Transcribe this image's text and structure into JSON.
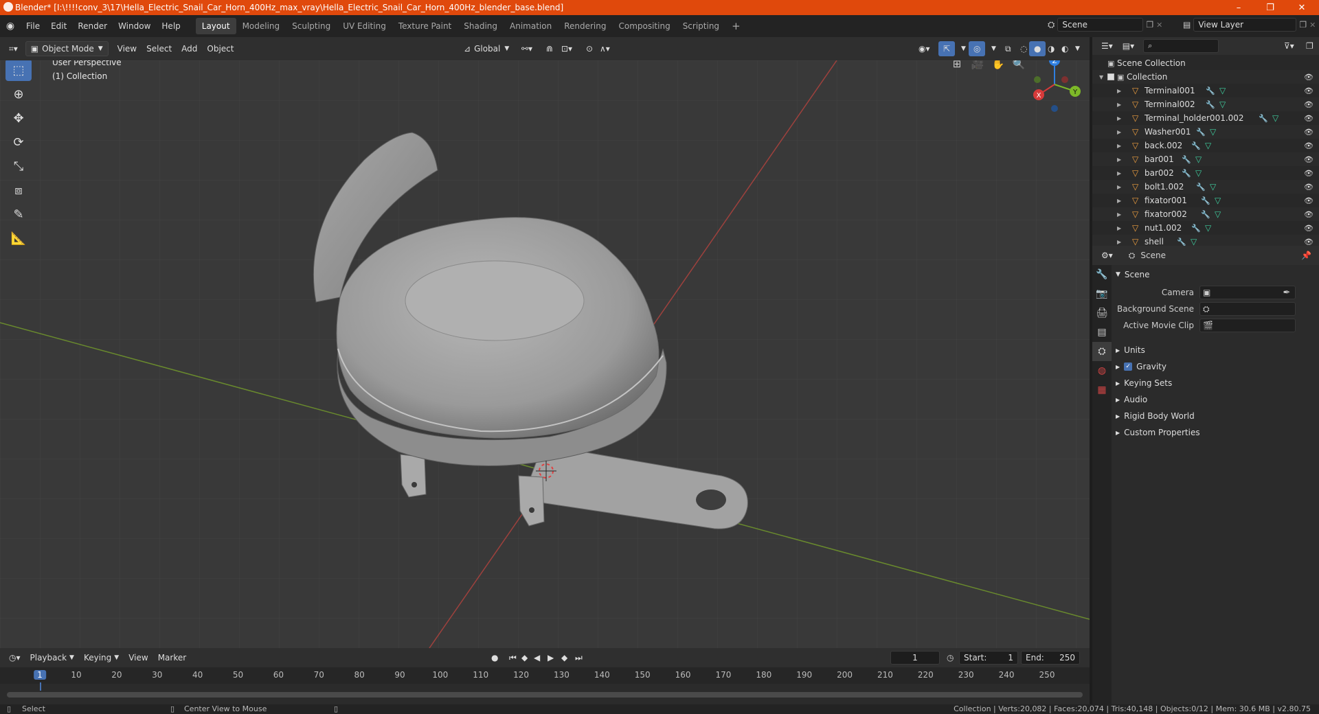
{
  "titlebar": {
    "title": "Blender* [I:\\!!!!conv_3\\17\\Hella_Electric_Snail_Car_Horn_400Hz_max_vray\\Hella_Electric_Snail_Car_Horn_400Hz_blender_base.blend]",
    "minimize": "–",
    "restore": "❐",
    "close": "✕"
  },
  "menu": [
    "File",
    "Edit",
    "Render",
    "Window",
    "Help"
  ],
  "workspaces": [
    "Layout",
    "Modeling",
    "Sculpting",
    "UV Editing",
    "Texture Paint",
    "Shading",
    "Animation",
    "Rendering",
    "Compositing",
    "Scripting"
  ],
  "active_workspace": "Layout",
  "add_workspace": "+",
  "scene_field": "Scene",
  "viewlayer_field": "View Layer",
  "vpheader": {
    "mode": "Object Mode",
    "view": "View",
    "select": "Select",
    "add": "Add",
    "object": "Object",
    "orientation": "Global"
  },
  "viewport": {
    "perspective": "User Perspective",
    "collection": "(1) Collection",
    "gizmo_axes": {
      "x": "X",
      "y": "Y",
      "z": "Z"
    }
  },
  "outliner": {
    "search_placeholder": "",
    "root": "Scene Collection",
    "collection": "Collection",
    "items": [
      "Terminal001",
      "Terminal002",
      "Terminal_holder001.002",
      "Washer001",
      "back.002",
      "bar001",
      "bar002",
      "bolt1.002",
      "fixator001",
      "fixator002",
      "nut1.002",
      "shell"
    ]
  },
  "properties": {
    "context": "Scene",
    "section": "Scene",
    "camera_label": "Camera",
    "bg_scene_label": "Background Scene",
    "movie_clip_label": "Active Movie Clip",
    "panels": [
      "Units",
      "Gravity",
      "Keying Sets",
      "Audio",
      "Rigid Body World",
      "Custom Properties"
    ],
    "gravity_checked": true
  },
  "timeline": {
    "playback": "Playback",
    "keying": "Keying",
    "view": "View",
    "marker": "Marker",
    "current_frame": "1",
    "start_label": "Start:",
    "start": "1",
    "end_label": "End:",
    "end": "250",
    "ruler_ticks": [
      "1",
      "10",
      "20",
      "30",
      "40",
      "50",
      "60",
      "70",
      "80",
      "90",
      "100",
      "110",
      "120",
      "130",
      "140",
      "150",
      "160",
      "170",
      "180",
      "190",
      "200",
      "210",
      "220",
      "230",
      "240",
      "250"
    ]
  },
  "statusbar": {
    "select": "Select",
    "center_view": "Center View to Mouse",
    "stats": "Collection | Verts:20,082 | Faces:20,074 | Tris:40,148 | Objects:0/12 | Mem: 30.6 MB | v2.80.75"
  },
  "colors": {
    "titlebar": "#e0490c",
    "accent": "#4772b3",
    "x_axis": "#d73a3a",
    "y_axis": "#7db928",
    "z_axis": "#2f7fe0",
    "object_icon": "#f0a040",
    "mesh_icon": "#3fd0a0"
  }
}
